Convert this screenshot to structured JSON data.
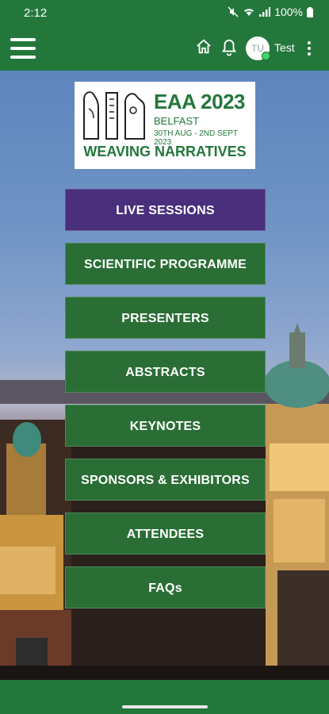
{
  "status_bar": {
    "time": "2:12",
    "battery": "100%"
  },
  "app_bar": {
    "avatar_initials": "TU",
    "user_name": "Test"
  },
  "event_logo": {
    "title": "EAA 2023",
    "city": "BELFAST",
    "dates": "30TH AUG - 2ND SEPT 2023",
    "tagline": "WEAVING NARRATIVES"
  },
  "menu": [
    {
      "label": "LIVE SESSIONS",
      "color": "#4a2f7d"
    },
    {
      "label": "SCIENTIFIC PROGRAMME",
      "color": "#2a6e35"
    },
    {
      "label": "PRESENTERS",
      "color": "#2a6e35"
    },
    {
      "label": "ABSTRACTS",
      "color": "#2a6e35"
    },
    {
      "label": "KEYNOTES",
      "color": "#2a6e35"
    },
    {
      "label": "SPONSORS & EXHIBITORS",
      "color": "#2a6e35"
    },
    {
      "label": "ATTENDEES",
      "color": "#2a6e35"
    },
    {
      "label": "FAQs",
      "color": "#2a6e35"
    }
  ],
  "colors": {
    "brand_green": "#23773b",
    "accent_purple": "#4a2f7d"
  }
}
